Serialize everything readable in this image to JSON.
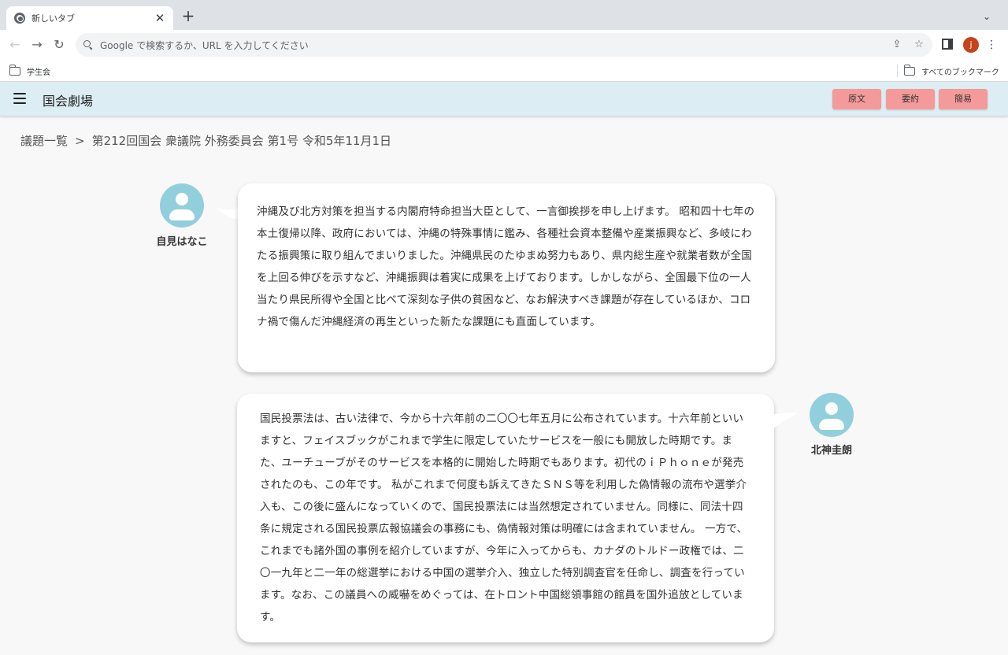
{
  "browser": {
    "tab_title": "新しいタブ",
    "tab_close": "✕",
    "new_tab": "+",
    "tab_search": "⌄",
    "back": "←",
    "forward": "→",
    "reload": "↻",
    "omnibox_placeholder": "Google で検索するか、URL を入力してください",
    "share_icon": "⇪",
    "star_icon": "☆",
    "profile_initial": "j",
    "menu_icon": "⋮",
    "bookmarks": [
      {
        "label": "学生会"
      }
    ],
    "all_bookmarks": "すべてのブックマーク"
  },
  "app": {
    "title": "国会劇場",
    "buttons": [
      "原文",
      "要約",
      "簡易"
    ]
  },
  "breadcrumb": {
    "root": "議題一覧",
    "separator": ">",
    "current": "第212回国会 衆議院 外務委員会 第1号 令和5年11月1日"
  },
  "speeches": [
    {
      "speaker": "自見はなこ",
      "text": "沖縄及び北方対策を担当する内閣府特命担当大臣として、一言御挨拶を申し上げます。 昭和四十七年の本土復帰以降、政府においては、沖縄の特殊事情に鑑み、各種社会資本整備や産業振興など、多岐にわたる振興策に取り組んでまいりました。沖縄県民のたゆまぬ努力もあり、県内総生産や就業者数が全国を上回る伸びを示すなど、沖縄振興は着実に成果を上げております。しかしながら、全国最下位の一人当たり県民所得や全国と比べて深刻な子供の貧困など、なお解決すべき課題が存在しているほか、コロナ禍で傷んだ沖縄経済の再生といった新たな課題にも直面しています。"
    },
    {
      "speaker": "北神圭朗",
      "text": "国民投票法は、古い法律で、今から十六年前の二〇〇七年五月に公布されています。十六年前といいますと、フェイスブックがこれまで学生に限定していたサービスを一般にも開放した時期です。また、ユーチューブがそのサービスを本格的に開始した時期でもあります。初代のｉＰｈｏｎｅが発売されたのも、この年です。 私がこれまで何度も訴えてきたＳＮＳ等を利用した偽情報の流布や選挙介入も、この後に盛んになっていくので、国民投票法には当然想定されていません。同様に、同法十四条に規定される国民投票広報協議会の事務にも、偽情報対策は明確には含まれていません。 一方で、これまでも諸外国の事例を紹介していますが、今年に入ってからも、カナダのトルドー政権では、二〇一九年と二一年の総選挙における中国の選挙介入、独立した特別調査官を任命し、調査を行っています。なお、この議員への威嚇をめぐっては、在トロント中国総領事館の館員を国外追放としています。"
    }
  ]
}
